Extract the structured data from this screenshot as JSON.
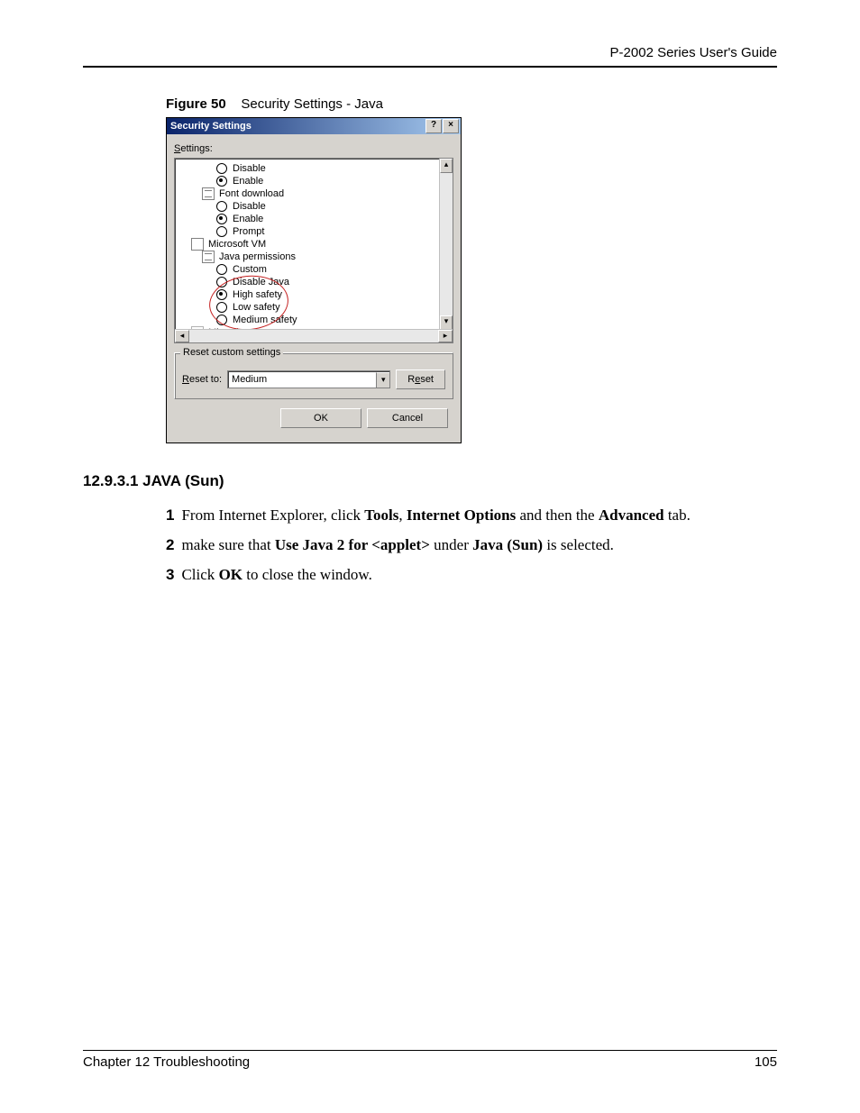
{
  "header": {
    "running_head": "P-2002 Series User's Guide"
  },
  "figure": {
    "label": "Figure 50",
    "caption": "Security Settings - Java"
  },
  "dialog": {
    "title": "Security Settings",
    "help_glyph": "?",
    "close_glyph": "×",
    "settings_label_before": "S",
    "settings_label_after": "ettings:",
    "tree": {
      "r1": "Disable",
      "r2": "Enable",
      "cat_font": "Font download",
      "r3": "Disable",
      "r4": "Enable",
      "r5": "Prompt",
      "cat_vm": "Microsoft VM",
      "sub_java": "Java permissions",
      "r6": "Custom",
      "r7": "Disable Java",
      "r8": "High safety",
      "r9": "Low safety",
      "r10": "Medium safety",
      "cut": "Miscellaneous"
    },
    "group": {
      "legend": "Reset custom settings",
      "reset_to_ul": "R",
      "reset_to_rest": "eset to:",
      "combo_value": "Medium",
      "reset_btn_before": "R",
      "reset_btn_ul": "e",
      "reset_btn_after": "set"
    },
    "buttons": {
      "ok": "OK",
      "cancel": "Cancel"
    },
    "scroll": {
      "up": "▴",
      "down": "▾",
      "left": "◂",
      "right": "▸"
    }
  },
  "section": {
    "heading": "12.9.3.1  JAVA (Sun)",
    "step1_a": "From Internet Explorer, click ",
    "step1_b1": "Tools",
    "step1_c": ", ",
    "step1_b2": "Internet Options",
    "step1_d": " and then the ",
    "step1_b3": "Advanced",
    "step1_e": " tab.",
    "step2_a": "make sure that ",
    "step2_b1": "Use Java 2 for <applet>",
    "step2_c": " under ",
    "step2_b2": "Java (Sun)",
    "step2_d": " is selected.",
    "step3_a": "Click ",
    "step3_b1": "OK",
    "step3_c": " to close the window."
  },
  "footer": {
    "chapter": "Chapter 12 Troubleshooting",
    "page": "105"
  },
  "nums": {
    "n1": "1",
    "n2": "2",
    "n3": "3"
  }
}
